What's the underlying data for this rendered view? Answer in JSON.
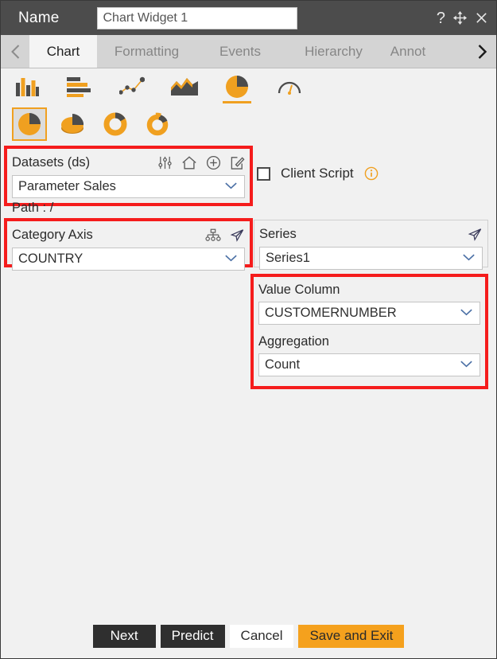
{
  "titlebar": {
    "name_label": "Name",
    "widget_name": "Chart Widget 1",
    "help_icon": "question-mark-icon",
    "move_icon": "move-arrows-icon",
    "close_icon": "close-icon"
  },
  "tabs": {
    "prev_icon": "chevron-left-icon",
    "next_icon": "chevron-right-icon",
    "items": [
      {
        "label": "Chart",
        "active": true
      },
      {
        "label": "Formatting",
        "active": false
      },
      {
        "label": "Events",
        "active": false
      },
      {
        "label": "Hierarchy",
        "active": false
      },
      {
        "label": "Annot",
        "active": false
      }
    ]
  },
  "chart_types": {
    "row1": [
      {
        "name": "column-chart-icon",
        "selected": false
      },
      {
        "name": "bar-chart-icon",
        "selected": false
      },
      {
        "name": "scatter-line-chart-icon",
        "selected": false
      },
      {
        "name": "area-chart-icon",
        "selected": false
      },
      {
        "name": "pie-chart-icon",
        "selected": true
      },
      {
        "name": "gauge-chart-icon",
        "selected": false
      }
    ],
    "row2": [
      {
        "name": "pie-flat-icon",
        "selected": true
      },
      {
        "name": "pie-3d-icon",
        "selected": false
      },
      {
        "name": "donut-icon",
        "selected": false
      },
      {
        "name": "donut-exploded-icon",
        "selected": false
      }
    ]
  },
  "datasets": {
    "title": "Datasets (ds)",
    "icons": [
      "sliders-icon",
      "home-icon",
      "plus-circle-icon",
      "edit-square-icon"
    ],
    "selected": "Parameter Sales",
    "path": "Path : /"
  },
  "client_script": {
    "label": "Client Script",
    "checked": false,
    "info_icon": "info-icon"
  },
  "category_axis": {
    "title": "Category Axis",
    "icons": [
      "hierarchy-icon",
      "send-icon"
    ],
    "selected": "COUNTRY"
  },
  "series": {
    "title": "Series",
    "icons": [
      "send-icon"
    ],
    "selected": "Series1"
  },
  "value_column": {
    "label": "Value Column",
    "selected": "CUSTOMERNUMBER"
  },
  "aggregation": {
    "label": "Aggregation",
    "selected": "Count"
  },
  "footer": {
    "next": "Next",
    "predict": "Predict",
    "cancel": "Cancel",
    "save_exit": "Save and Exit"
  },
  "colors": {
    "accent_orange": "#f5a11d",
    "highlight_red": "#f51c1c",
    "titlebar": "#4c4c4c",
    "body_bg": "#f1f1f1",
    "dark_button": "#2f2f2f"
  }
}
